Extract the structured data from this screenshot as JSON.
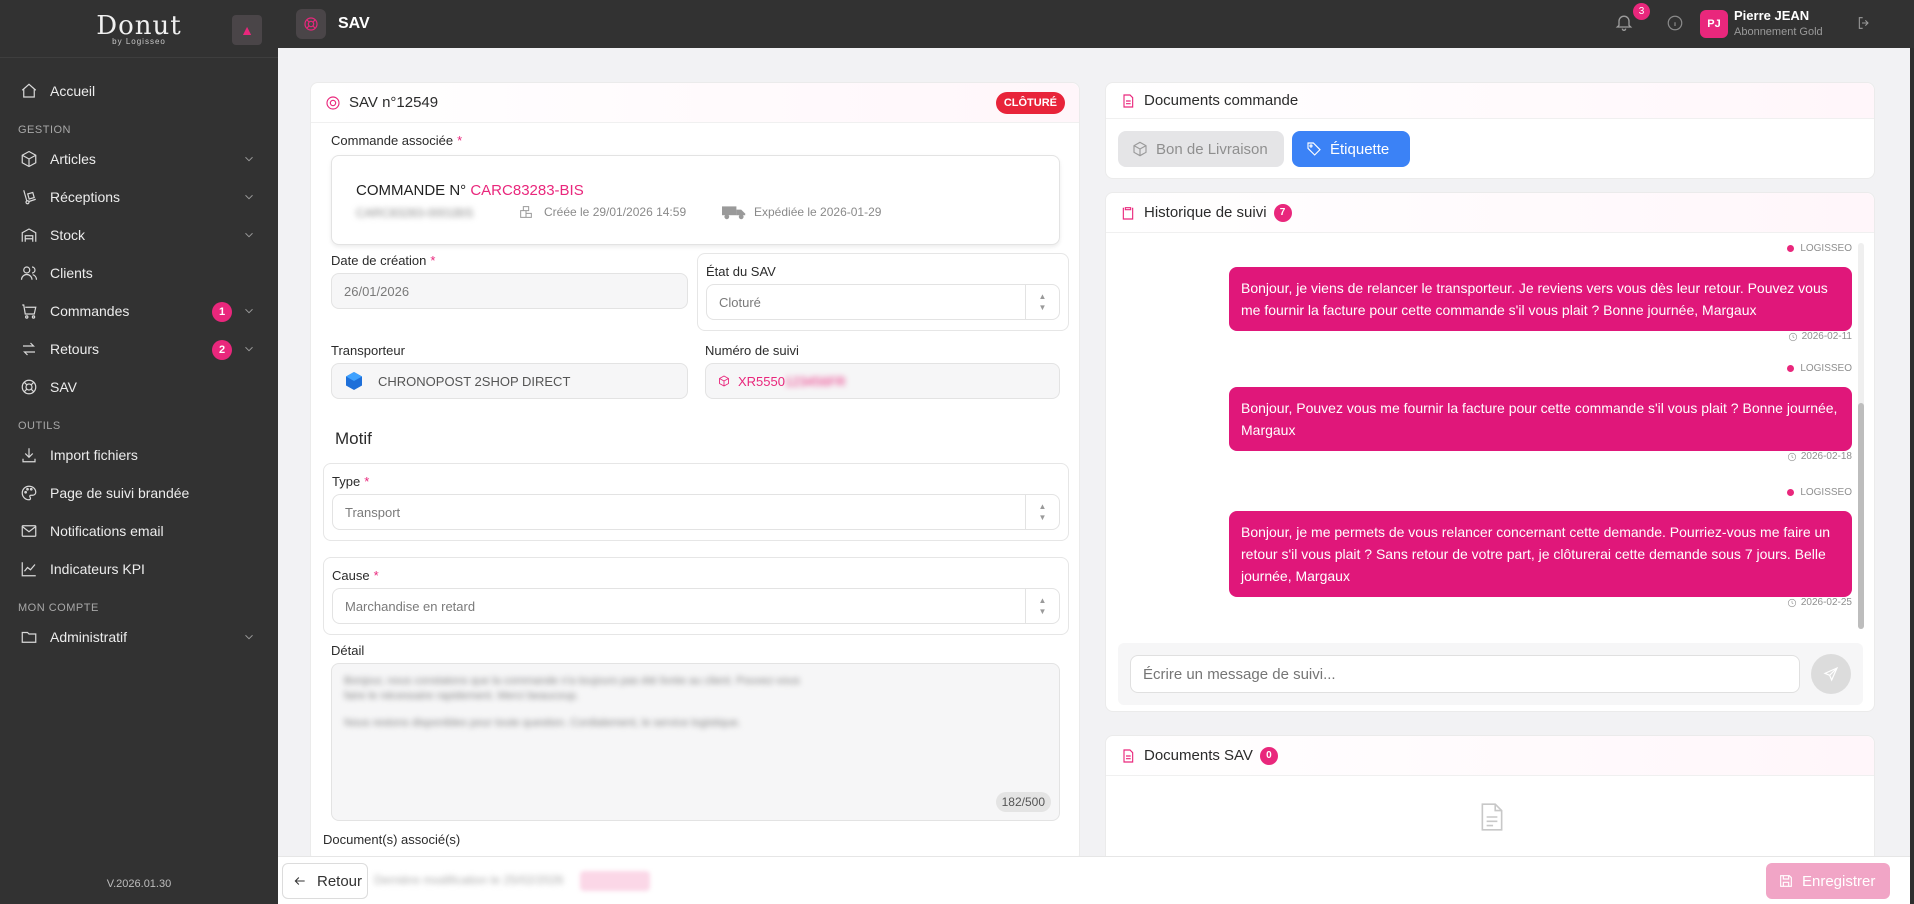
{
  "app": {
    "logo_text": "Donut",
    "logo_sub": "by Logisseo",
    "version": "V.2026.01.30"
  },
  "sidebar": {
    "items": [
      {
        "label": "Accueil",
        "icon": "home-icon"
      },
      {
        "section": "GESTION"
      },
      {
        "label": "Articles",
        "icon": "box-icon",
        "chevron": true
      },
      {
        "label": "Réceptions",
        "icon": "dolly-icon",
        "chevron": true
      },
      {
        "label": "Stock",
        "icon": "stock-icon",
        "chevron": true
      },
      {
        "label": "Clients",
        "icon": "users-icon"
      },
      {
        "label": "Commandes",
        "icon": "cart-icon",
        "chevron": true,
        "badge": "1"
      },
      {
        "label": "Retours",
        "icon": "return-icon",
        "chevron": true,
        "badge": "2"
      },
      {
        "label": "SAV",
        "icon": "lifebuoy-icon"
      },
      {
        "section": "OUTILS"
      },
      {
        "label": "Import fichiers",
        "icon": "download-icon"
      },
      {
        "label": "Page de suivi brandée",
        "icon": "palette-icon"
      },
      {
        "label": "Notifications email",
        "icon": "mail-icon"
      },
      {
        "label": "Indicateurs KPI",
        "icon": "chart-icon"
      },
      {
        "section": "MON COMPTE"
      },
      {
        "label": "Administratif",
        "icon": "folder-icon",
        "chevron": true
      }
    ]
  },
  "topbar": {
    "title": "SAV",
    "notification_count": "3",
    "user_initials": "PJ",
    "user_name": "Pierre JEAN",
    "user_plan": "Abonnement Gold"
  },
  "sav": {
    "title": "SAV n°12549",
    "status_badge": "CLÔTURÉ",
    "commande_label": "Commande associée",
    "commande_prefix": "COMMANDE N°",
    "commande_number": "CARC83283-BIS",
    "commande_hidden": "CARC83283-0001BIS",
    "created": "Créée le 29/01/2026 14:59",
    "shipped": "Expédiée le 2026-01-29",
    "date_label": "Date de création",
    "date_value": "26/01/2026",
    "etat_label": "État du SAV",
    "etat_value": "Cloturé",
    "transporteur_label": "Transporteur",
    "transporteur_value": "CHRONOPOST 2SHOP DIRECT",
    "suivi_label": "Numéro de suivi",
    "suivi_value": "XR5550",
    "suivi_hidden": "123456FR",
    "motif_title": "Motif",
    "type_label": "Type",
    "type_value": "Transport",
    "cause_label": "Cause",
    "cause_value": "Marchandise en retard",
    "detail_label": "Détail",
    "detail_text_1": "Bonjour, nous constatons que la commande n'a toujours pas été livrée au client. Pouvez-vous",
    "detail_text_2": "faire le nécessaire rapidement. Merci beaucoup.",
    "detail_text_3": "Nous restons disponibles pour toute question. Cordialement, le service logistique.",
    "detail_counter": "182/500",
    "docs_label": "Document(s) associé(s)"
  },
  "documents_commande": {
    "title": "Documents commande",
    "btn_livraison": "Bon de Livraison",
    "btn_etiquette": "Étiquette"
  },
  "historique": {
    "title": "Historique de suivi",
    "count": "7",
    "messages": [
      {
        "author": "LOGISSEO",
        "text": "Bonjour, je viens de relancer le transporteur. Je reviens vers vous dès leur retour. Pouvez vous me fournir la facture pour cette commande s'il vous plait ? Bonne journée, Margaux",
        "date": "2026-02-11"
      },
      {
        "author": "LOGISSEO",
        "text": "Bonjour, Pouvez vous me fournir la facture pour cette commande s'il vous plait ? Bonne journée, Margaux",
        "date": "2026-02-18"
      },
      {
        "author": "LOGISSEO",
        "text": "Bonjour, je me permets de vous relancer concernant cette demande. Pourriez-vous me faire un retour s'il vous plait ? Sans retour de votre part, je clôturerai cette demande sous 7 jours. Belle journée, Margaux",
        "date": "2026-02-25"
      }
    ],
    "input_placeholder": "Écrire un message de suivi..."
  },
  "documents_sav": {
    "title": "Documents SAV",
    "count": "0"
  },
  "footer": {
    "back_label": "Retour",
    "save_label": "Enregistrer",
    "hidden_status": "Dernière modification le 25/02/2026"
  },
  "colors": {
    "accent": "#e9277c",
    "sidebar_bg": "#323232",
    "danger": "#e8243a",
    "primary_blue": "#3b82f6"
  }
}
